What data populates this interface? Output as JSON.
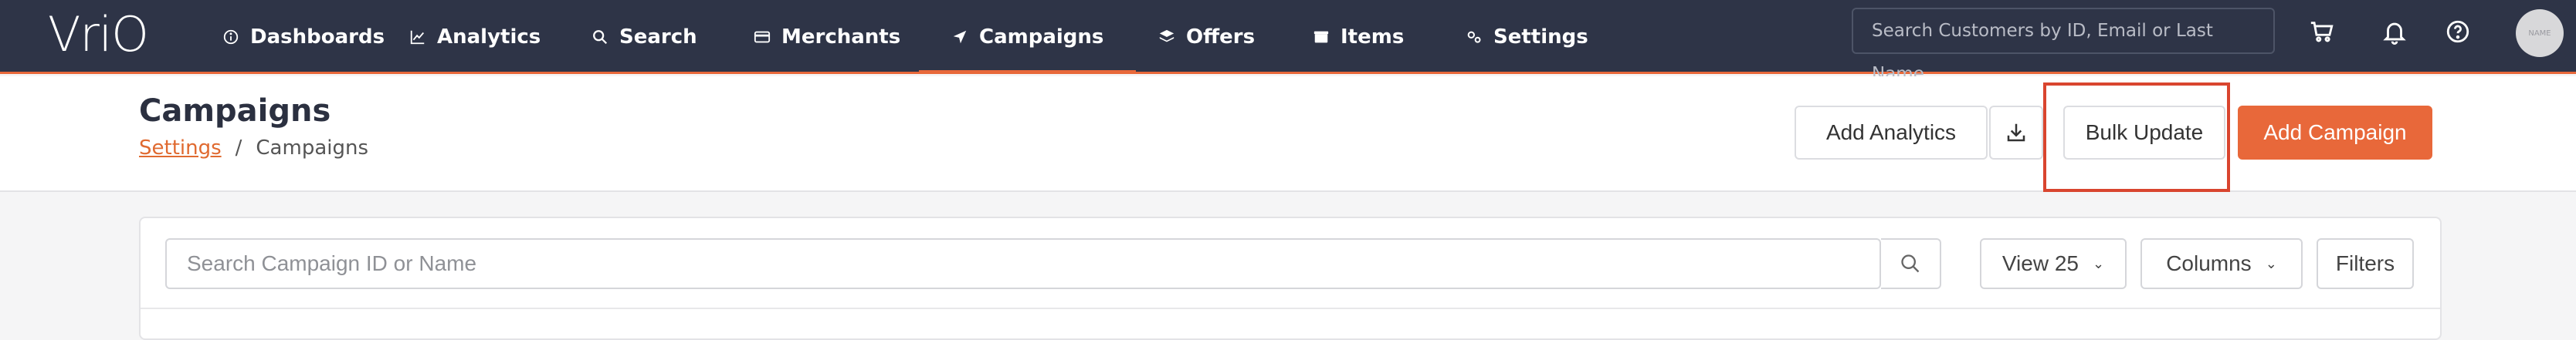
{
  "brand": {
    "logo_text": "VriO",
    "accent_color": "#e8683a",
    "nav_bg": "#2e3447"
  },
  "nav": {
    "items": [
      {
        "label": "Dashboards",
        "icon": "info-circle-icon"
      },
      {
        "label": "Analytics",
        "icon": "line-chart-icon"
      },
      {
        "label": "Search",
        "icon": "search-icon"
      },
      {
        "label": "Merchants",
        "icon": "credit-card-icon"
      },
      {
        "label": "Campaigns",
        "icon": "paper-plane-icon",
        "active": true
      },
      {
        "label": "Offers",
        "icon": "layers-icon"
      },
      {
        "label": "Items",
        "icon": "box-icon"
      },
      {
        "label": "Settings",
        "icon": "gears-icon"
      }
    ],
    "global_search_placeholder": "Search Customers by ID, Email or Last Name",
    "avatar_text": "NAME"
  },
  "header": {
    "title": "Campaigns",
    "breadcrumb": {
      "parent": "Settings",
      "separator": "/",
      "current": "Campaigns"
    },
    "buttons": {
      "add_analytics": "Add Analytics",
      "bulk_update": "Bulk Update",
      "add_campaign": "Add Campaign"
    }
  },
  "toolbar": {
    "search_placeholder": "Search Campaign ID or Name",
    "view_label": "View 25",
    "columns_label": "Columns",
    "filters_label": "Filters"
  }
}
